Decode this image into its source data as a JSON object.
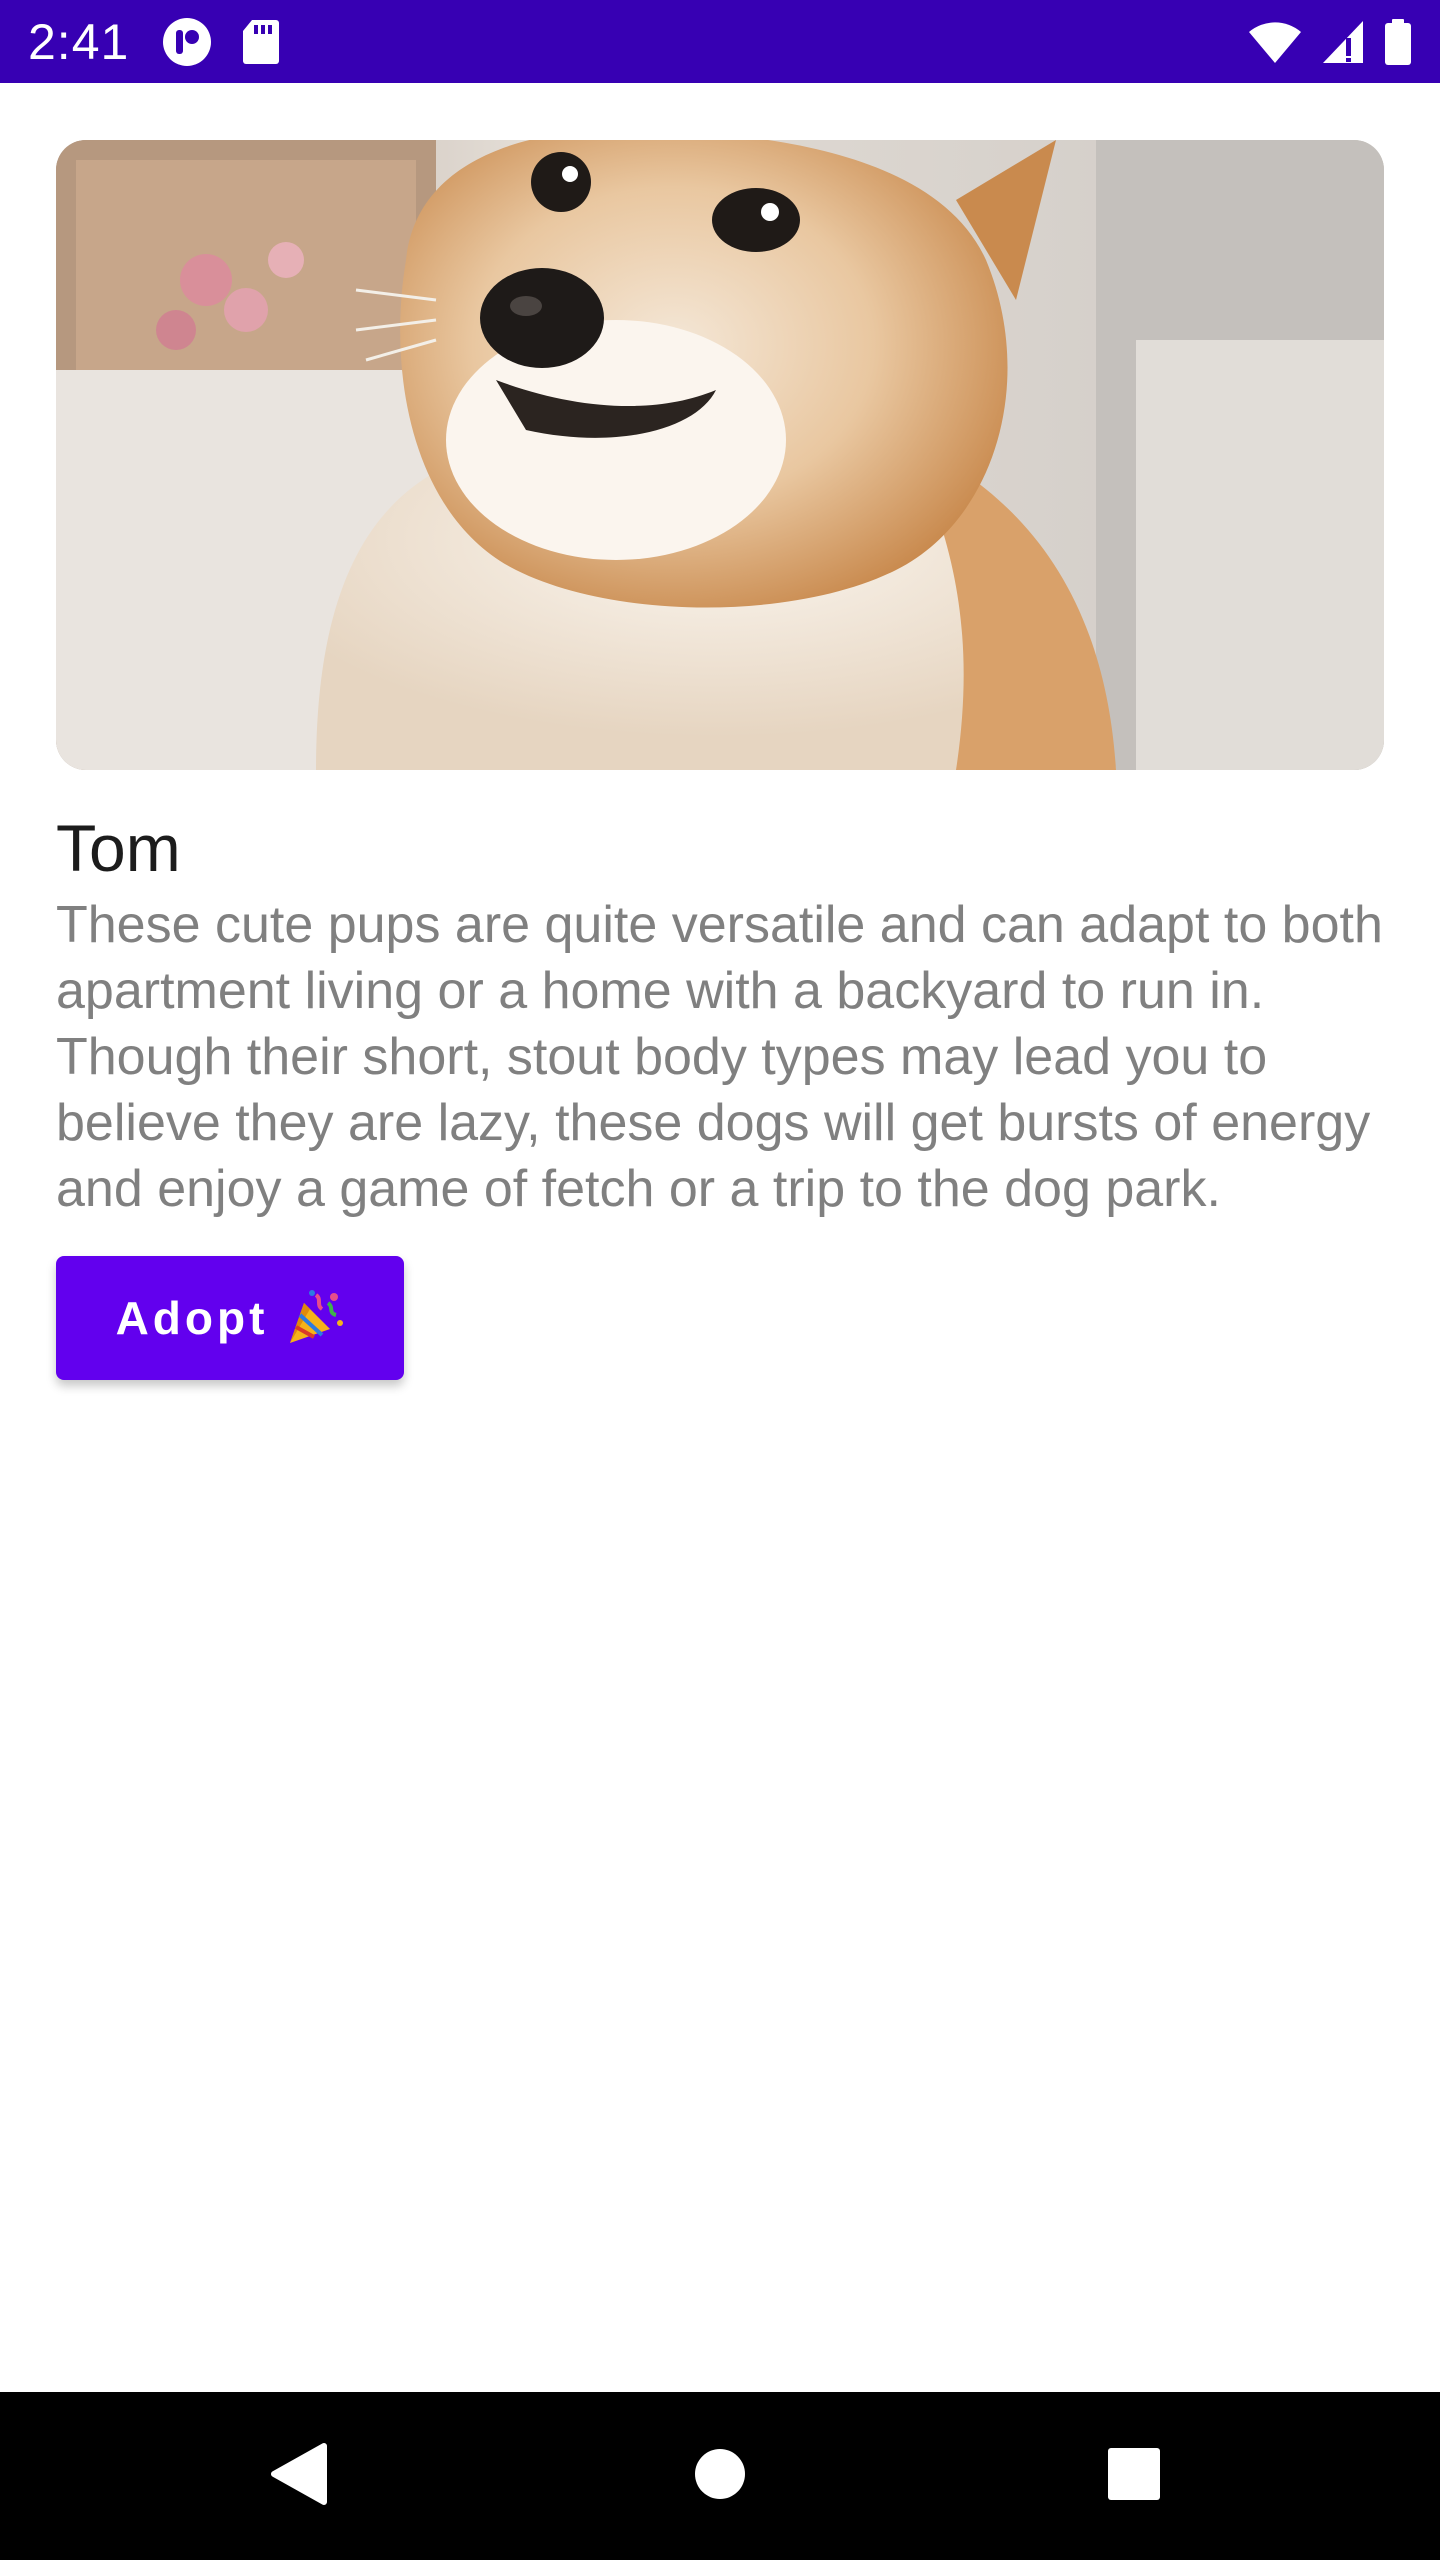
{
  "status_bar": {
    "time": "2:41",
    "background": "#3700b3",
    "left_icons": [
      "notification-app-icon",
      "sd-card-icon"
    ],
    "right_icons": [
      "wifi-icon",
      "cell-signal-icon",
      "battery-icon"
    ]
  },
  "hero_image": {
    "subject": "shiba-inu-dog-photo"
  },
  "pet": {
    "name": "Tom",
    "description": "These cute pups are quite versatile and can adapt to both apartment living or a home with a backyard to run in. Though their short, stout body types may lead you to believe they are lazy, these dogs will get bursts of energy and enjoy a game of fetch or a trip to the dog park."
  },
  "adopt_button": {
    "label": "Adopt",
    "emoji_icon": "party-popper-icon",
    "color": "#6200ee"
  },
  "nav_bar": {
    "buttons": [
      "back-icon",
      "home-icon",
      "recents-icon"
    ],
    "background": "#000000"
  }
}
